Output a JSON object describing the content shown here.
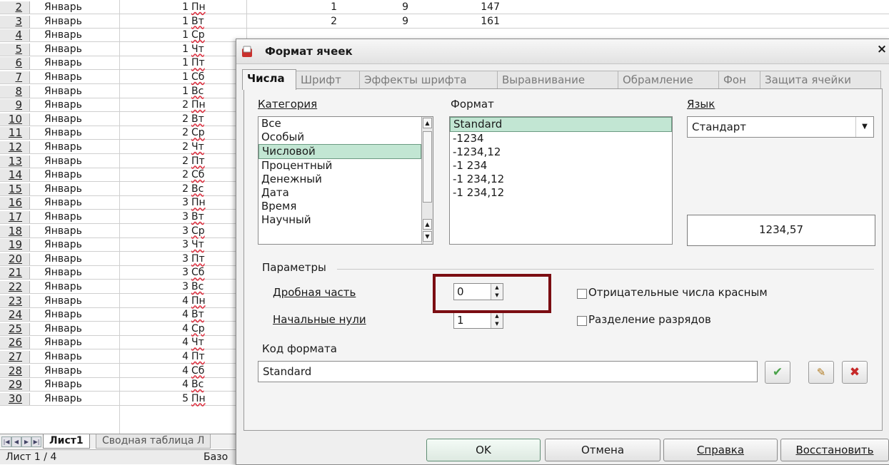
{
  "sheet": {
    "rows": [
      {
        "n": "2",
        "m": "Январь",
        "d": "1",
        "w": "Пн",
        "x": "1",
        "y": "9",
        "z": "147"
      },
      {
        "n": "3",
        "m": "Январь",
        "d": "1",
        "w": "Вт",
        "x": "2",
        "y": "9",
        "z": "161"
      },
      {
        "n": "4",
        "m": "Январь",
        "d": "1",
        "w": "Ср"
      },
      {
        "n": "5",
        "m": "Январь",
        "d": "1",
        "w": "Чт"
      },
      {
        "n": "6",
        "m": "Январь",
        "d": "1",
        "w": "Пт"
      },
      {
        "n": "7",
        "m": "Январь",
        "d": "1",
        "w": "Сб"
      },
      {
        "n": "8",
        "m": "Январь",
        "d": "1",
        "w": "Вс"
      },
      {
        "n": "9",
        "m": "Январь",
        "d": "2",
        "w": "Пн"
      },
      {
        "n": "10",
        "m": "Январь",
        "d": "2",
        "w": "Вт"
      },
      {
        "n": "11",
        "m": "Январь",
        "d": "2",
        "w": "Ср"
      },
      {
        "n": "12",
        "m": "Январь",
        "d": "2",
        "w": "Чт"
      },
      {
        "n": "13",
        "m": "Январь",
        "d": "2",
        "w": "Пт"
      },
      {
        "n": "14",
        "m": "Январь",
        "d": "2",
        "w": "Сб"
      },
      {
        "n": "15",
        "m": "Январь",
        "d": "2",
        "w": "Вс"
      },
      {
        "n": "16",
        "m": "Январь",
        "d": "3",
        "w": "Пн"
      },
      {
        "n": "17",
        "m": "Январь",
        "d": "3",
        "w": "Вт"
      },
      {
        "n": "18",
        "m": "Январь",
        "d": "3",
        "w": "Ср"
      },
      {
        "n": "19",
        "m": "Январь",
        "d": "3",
        "w": "Чт"
      },
      {
        "n": "20",
        "m": "Январь",
        "d": "3",
        "w": "Пт"
      },
      {
        "n": "21",
        "m": "Январь",
        "d": "3",
        "w": "Сб"
      },
      {
        "n": "22",
        "m": "Январь",
        "d": "3",
        "w": "Вс"
      },
      {
        "n": "23",
        "m": "Январь",
        "d": "4",
        "w": "Пн"
      },
      {
        "n": "24",
        "m": "Январь",
        "d": "4",
        "w": "Вт"
      },
      {
        "n": "25",
        "m": "Январь",
        "d": "4",
        "w": "Ср"
      },
      {
        "n": "26",
        "m": "Январь",
        "d": "4",
        "w": "Чт"
      },
      {
        "n": "27",
        "m": "Январь",
        "d": "4",
        "w": "Пт"
      },
      {
        "n": "28",
        "m": "Январь",
        "d": "4",
        "w": "Сб"
      },
      {
        "n": "29",
        "m": "Январь",
        "d": "4",
        "w": "Вс"
      },
      {
        "n": "30",
        "m": "Январь",
        "d": "5",
        "w": "Пн"
      }
    ],
    "tabs": {
      "active": "Лист1",
      "other": "Сводная таблица Л"
    },
    "status": {
      "page": "Лист 1 / 4",
      "style": "Базо"
    }
  },
  "dialog": {
    "title": "Формат ячеек",
    "close": "×",
    "tabs": [
      "Числа",
      "Шрифт",
      "Эффекты шрифта",
      "Выравнивание",
      "Обрамление",
      "Фон",
      "Защита ячейки"
    ],
    "category": {
      "label": "Категория",
      "items": [
        "Все",
        "Особый",
        "Числовой",
        "Процентный",
        "Денежный",
        "Дата",
        "Время",
        "Научный"
      ],
      "selected": "Числовой"
    },
    "format": {
      "label": "Формат",
      "items": [
        "Standard",
        "-1234",
        "-1234,12",
        "-1 234",
        "-1 234,12",
        "-1 234,12"
      ],
      "selected": "Standard"
    },
    "language": {
      "label": "Язык",
      "value": "Стандарт"
    },
    "preview": "1234,57",
    "params": {
      "label": "Параметры",
      "decimal_label": "Дробная часть",
      "decimal_value": "0",
      "leading_label": "Начальные нули",
      "leading_value": "1",
      "negative_red": "Отрицательные числа красным",
      "thousands": "Разделение разрядов"
    },
    "code": {
      "label": "Код формата",
      "value": "Standard"
    },
    "buttons": {
      "ok": "OK",
      "cancel": "Отмена",
      "help": "Справка",
      "reset": "Восстановить"
    }
  },
  "colors": {
    "selection": "#c2e6d3",
    "highlight": "#7b0d12"
  }
}
